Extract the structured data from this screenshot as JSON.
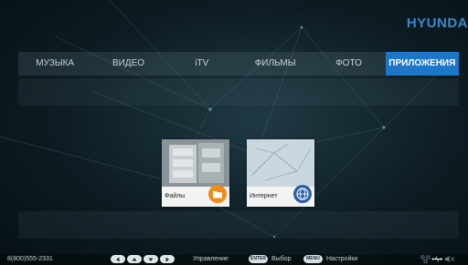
{
  "brand": "HYUNDA",
  "menu": {
    "items": [
      {
        "label": "МУЗЫКА"
      },
      {
        "label": "ВИДЕО"
      },
      {
        "label": "iTV"
      },
      {
        "label": "ФИЛЬМЫ"
      },
      {
        "label": "ФОТО"
      },
      {
        "label": "ПРИЛОЖЕНИЯ"
      }
    ],
    "active_index": 5
  },
  "apps": [
    {
      "label": "Файлы",
      "icon": "folder-icon"
    },
    {
      "label": "Интернет",
      "icon": "globe-icon"
    }
  ],
  "status_bar": {
    "phone": "8(800)555-2331",
    "nav_hint": "Управление",
    "enter_key": "ENTER",
    "enter_hint": "Выбор",
    "menu_key": "MENU",
    "menu_hint": "Настройки",
    "icons": [
      "network-icon",
      "usb-icon",
      "mute-icon"
    ]
  },
  "colors": {
    "accent": "#1d76c7",
    "brand": "#3c86c8",
    "folder_badge": "#f08a1c",
    "globe_badge": "#2e5fa8"
  }
}
